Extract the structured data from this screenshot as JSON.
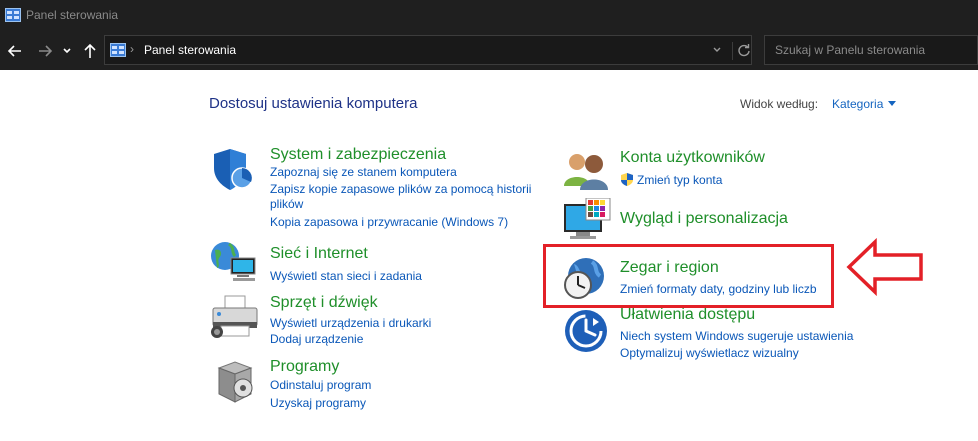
{
  "window": {
    "title": "Panel sterowania"
  },
  "address": {
    "crumb": "Panel sterowania"
  },
  "search": {
    "placeholder": "Szukaj w Panelu sterowania"
  },
  "page": {
    "heading": "Dostosuj ustawienia komputera",
    "view_by_label": "Widok według:",
    "view_by_value": "Kategoria"
  },
  "left": [
    {
      "title": "System i zabezpieczenia",
      "links": [
        "Zapoznaj się ze stanem komputera",
        "Zapisz kopie zapasowe plików za pomocą historii",
        "plików",
        "Kopia zapasowa i przywracanie (Windows 7)"
      ]
    },
    {
      "title": "Sieć i Internet",
      "links": [
        "Wyświetl stan sieci i zadania"
      ]
    },
    {
      "title": "Sprzęt i dźwięk",
      "links": [
        "Wyświetl urządzenia i drukarki",
        "Dodaj urządzenie"
      ]
    },
    {
      "title": "Programy",
      "links": [
        "Odinstaluj program",
        "Uzyskaj programy"
      ]
    }
  ],
  "right": [
    {
      "title": "Konta użytkowników",
      "links": [
        "Zmień typ konta"
      ]
    },
    {
      "title": "Wygląd i personalizacja",
      "links": []
    },
    {
      "title": "Zegar i region",
      "links": [
        "Zmień formaty daty, godziny lub liczb"
      ]
    },
    {
      "title": "Ułatwienia dostępu",
      "links": [
        "Niech system Windows sugeruje ustawienia",
        "Optymalizuj wyświetlacz wizualny"
      ]
    }
  ],
  "colors": {
    "category_title": "#1f8f2a",
    "link": "#0a57b8",
    "heading": "#1e3287",
    "annotation": "#e32027"
  },
  "icons": [
    "control-panel-icon",
    "back-arrow-icon",
    "forward-arrow-icon",
    "chevron-down-icon",
    "up-arrow-icon",
    "refresh-icon",
    "shield-icon",
    "network-globe-icon",
    "printer-icon",
    "programs-box-icon",
    "users-icon",
    "personalization-monitor-icon",
    "clock-globe-icon",
    "ease-of-access-icon",
    "uac-shield-icon",
    "red-arrow-icon"
  ]
}
